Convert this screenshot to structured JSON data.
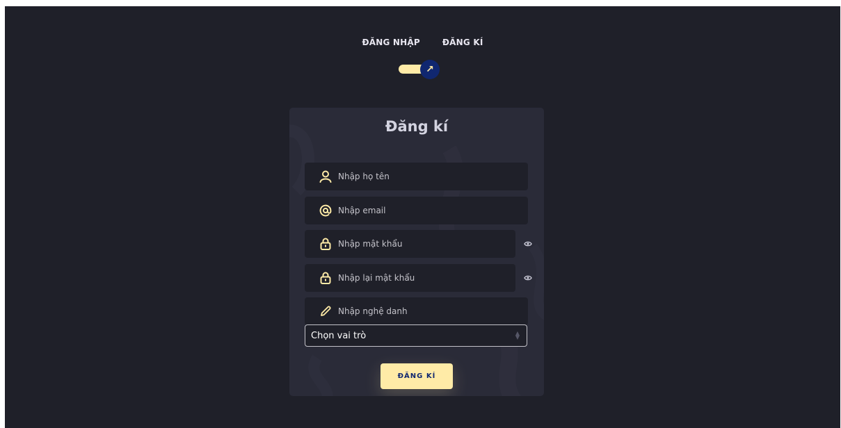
{
  "switch": {
    "login_label": "ĐĂNG NHẬP",
    "signup_label": "ĐĂNG KÍ",
    "knob_icon": "arrow-up-right-icon",
    "knob_glyph": "↗"
  },
  "form": {
    "title": "Đăng kí",
    "fields": [
      {
        "placeholder": "Nhập họ tên",
        "icon": "user-icon"
      },
      {
        "placeholder": "Nhập email",
        "icon": "at-icon"
      },
      {
        "placeholder": "Nhập mật khẩu",
        "icon": "lock-icon"
      },
      {
        "placeholder": "Nhập lại mật khẩu",
        "icon": "lock-icon"
      },
      {
        "placeholder": "Nhập nghệ danh",
        "icon": "pencil-icon"
      }
    ],
    "role_select": {
      "selected": "Chọn vai trò"
    },
    "submit_label": "ĐĂNG KÍ"
  },
  "colors": {
    "background": "#1f2029",
    "card": "#2a2b38",
    "accent": "#ffeba7",
    "accent_dark": "#102770",
    "text_muted": "#c4c3ca"
  }
}
